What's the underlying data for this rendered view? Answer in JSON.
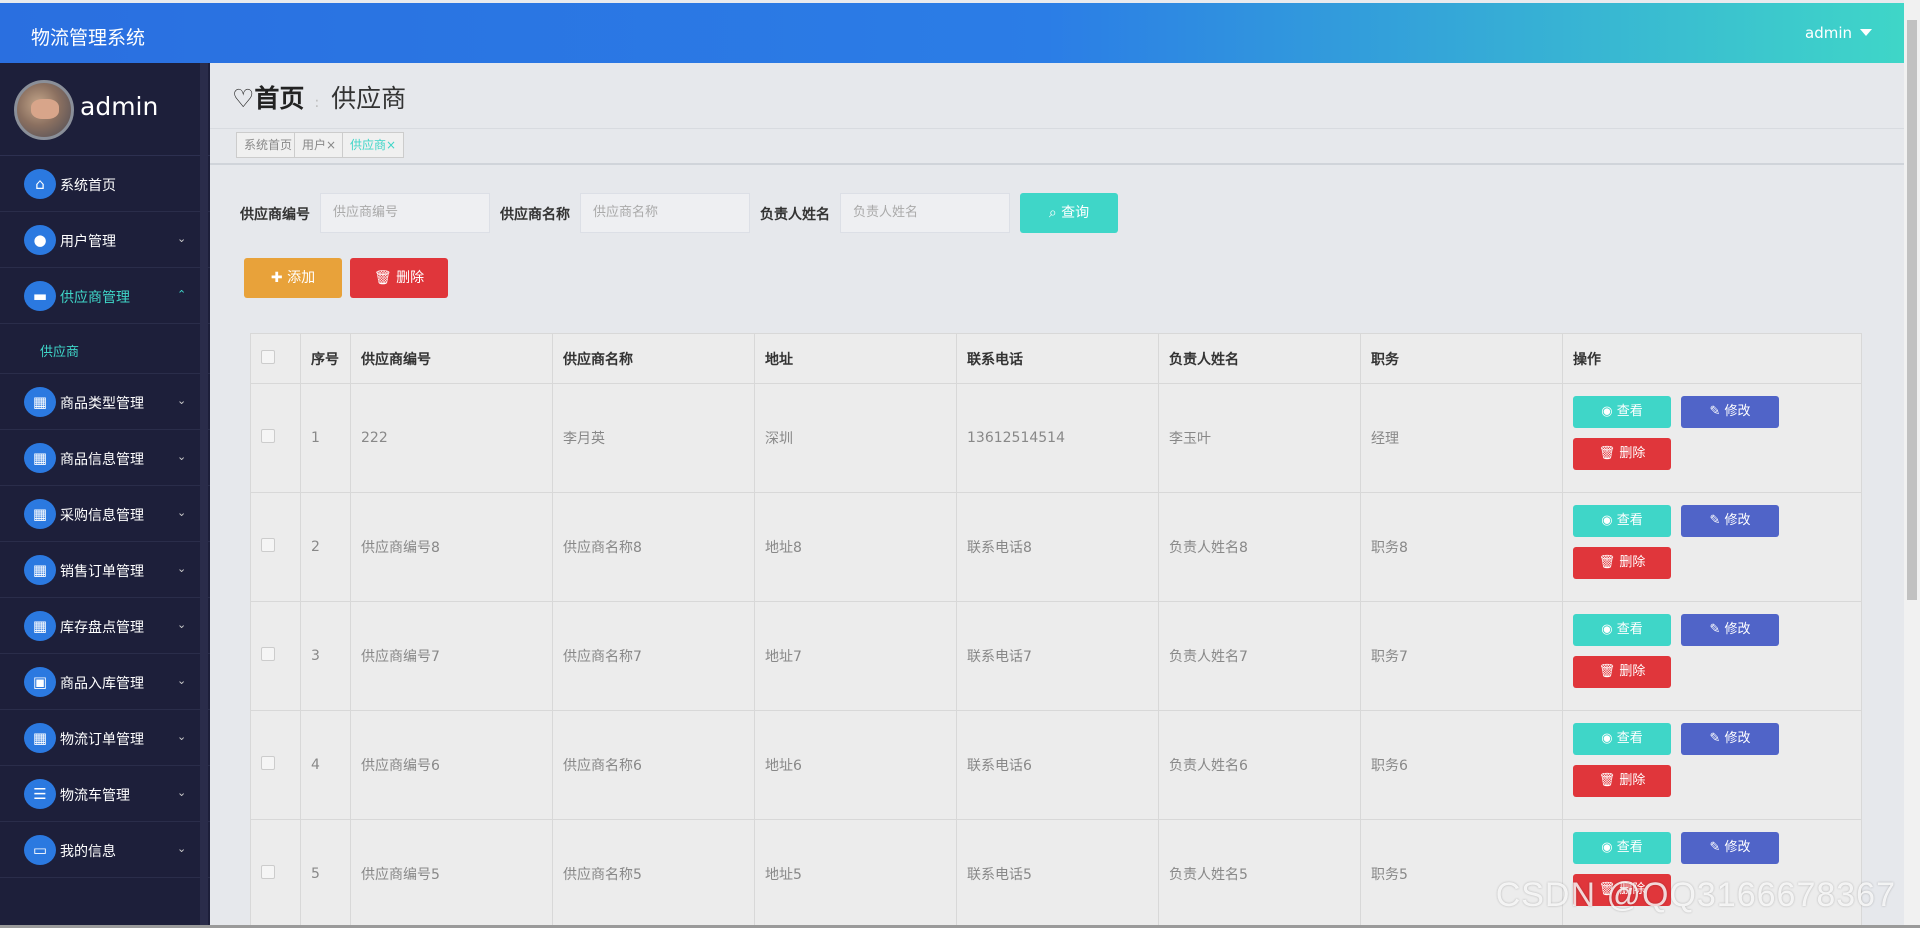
{
  "topbar": {
    "brand": "物流管理系统",
    "user": "admin"
  },
  "sidebar": {
    "username": "admin",
    "items": [
      {
        "label": "系统首页",
        "icon": "home-icon",
        "glyph": "⌂",
        "arrow": ""
      },
      {
        "label": "用户管理",
        "icon": "bulb-icon",
        "glyph": "●",
        "arrow": "⌄"
      },
      {
        "label": "供应商管理",
        "icon": "chat-icon",
        "glyph": "▬",
        "arrow": "⌃"
      },
      {
        "label": "商品类型管理",
        "icon": "grid-icon",
        "glyph": "▦",
        "arrow": "⌄"
      },
      {
        "label": "商品信息管理",
        "icon": "grid-icon",
        "glyph": "▦",
        "arrow": "⌄"
      },
      {
        "label": "采购信息管理",
        "icon": "grid-icon",
        "glyph": "▦",
        "arrow": "⌄"
      },
      {
        "label": "销售订单管理",
        "icon": "grid-icon",
        "glyph": "▦",
        "arrow": "⌄"
      },
      {
        "label": "库存盘点管理",
        "icon": "grid-icon",
        "glyph": "▦",
        "arrow": "⌄"
      },
      {
        "label": "商品入库管理",
        "icon": "briefcase-icon",
        "glyph": "▣",
        "arrow": "⌄"
      },
      {
        "label": "物流订单管理",
        "icon": "grid-icon",
        "glyph": "▦",
        "arrow": "⌄"
      },
      {
        "label": "物流车管理",
        "icon": "list-icon",
        "glyph": "☰",
        "arrow": "⌄"
      },
      {
        "label": "我的信息",
        "icon": "card-icon",
        "glyph": "▭",
        "arrow": "⌄"
      }
    ],
    "sub_item": "供应商"
  },
  "breadcrumb": {
    "home": "首页",
    "sep": ":",
    "current": "供应商"
  },
  "tabs": [
    "系统首页",
    "用户×",
    "供应商×"
  ],
  "search": {
    "code_label": "供应商编号",
    "code_placeholder": "供应商编号",
    "name_label": "供应商名称",
    "name_placeholder": "供应商名称",
    "contact_label": "负责人姓名",
    "contact_placeholder": "负责人姓名",
    "query_label": "查询"
  },
  "actions": {
    "add_label": "添加",
    "delete_label": "删除"
  },
  "table": {
    "headers": [
      "序号",
      "供应商编号",
      "供应商名称",
      "地址",
      "联系电话",
      "负责人姓名",
      "职务",
      "操作"
    ],
    "rows": [
      [
        "1",
        "222",
        "李月英",
        "深圳",
        "13612514514",
        "李玉叶",
        "经理"
      ],
      [
        "2",
        "供应商编号8",
        "供应商名称8",
        "地址8",
        "联系电话8",
        "负责人姓名8",
        "职务8"
      ],
      [
        "3",
        "供应商编号7",
        "供应商名称7",
        "地址7",
        "联系电话7",
        "负责人姓名7",
        "职务7"
      ],
      [
        "4",
        "供应商编号6",
        "供应商名称6",
        "地址6",
        "联系电话6",
        "负责人姓名6",
        "职务6"
      ],
      [
        "5",
        "供应商编号5",
        "供应商名称5",
        "地址5",
        "联系电话5",
        "负责人姓名5",
        "职务5"
      ]
    ],
    "op_view": "查看",
    "op_edit": "修改",
    "op_delete": "删除"
  },
  "watermark": "CSDN @QQ3166678367",
  "colors": {
    "accent": "#3fd6c8",
    "primary": "#2b79e0",
    "danger": "#e0363b",
    "warning": "#e8a23a",
    "edit": "#5064c8",
    "sidebar": "#1d1f3a"
  }
}
